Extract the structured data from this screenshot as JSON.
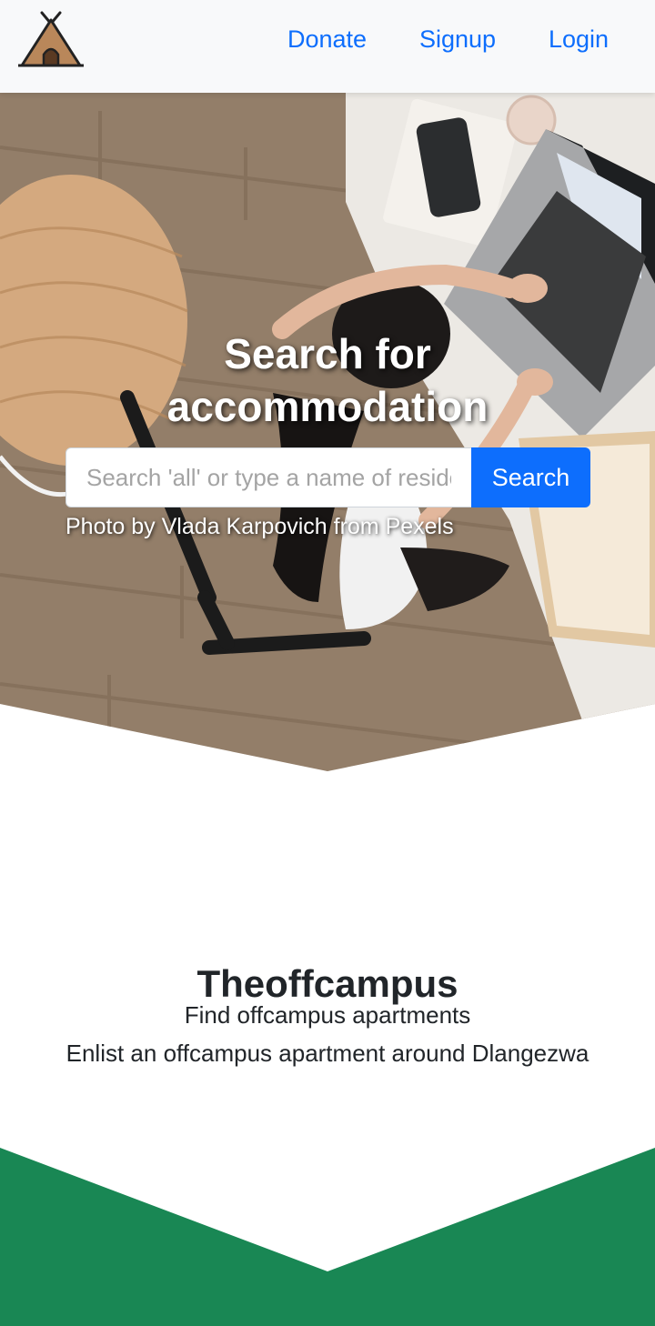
{
  "navbar": {
    "brand_icon": "tent-icon",
    "links": [
      {
        "label": "Donate"
      },
      {
        "label": "Signup"
      },
      {
        "label": "Login"
      }
    ]
  },
  "hero": {
    "title_line1": "Search for",
    "title_line2": "accommodation",
    "search": {
      "placeholder": "Search 'all' or type a name of residence",
      "value": "",
      "button_label": "Search"
    },
    "photo_credit": "Photo by Vlada Karpovich from Pexels"
  },
  "about": {
    "title": "Theoffcampus",
    "line1": "Find offcampus apartments",
    "line2": "Enlist an offcampus apartment around Dlangezwa"
  },
  "colors": {
    "primary": "#0d6efd",
    "navbar_bg": "#f8f9fa",
    "band_green": "#198754",
    "text_dark": "#212529"
  }
}
